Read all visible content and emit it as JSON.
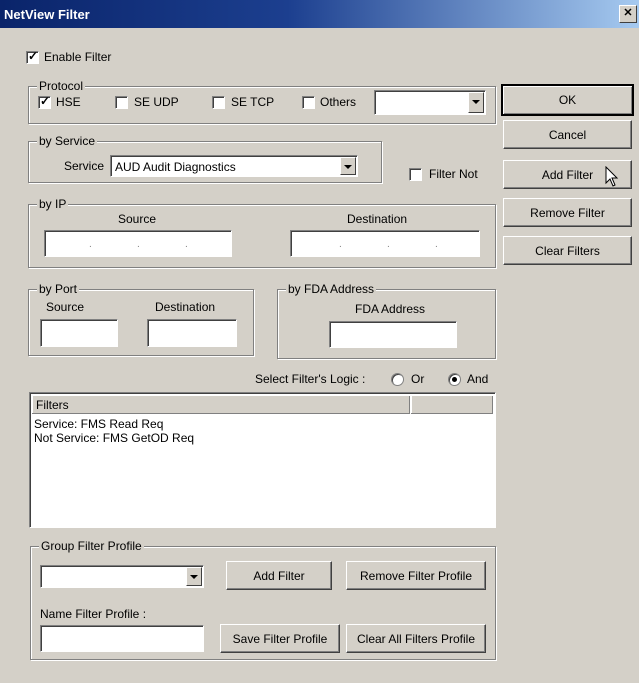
{
  "window": {
    "title": "NetView Filter",
    "close_glyph": "✕"
  },
  "enable_filter": {
    "label": "Enable Filter",
    "checked": true
  },
  "protocol": {
    "group_label": "Protocol",
    "options": [
      {
        "label": "HSE",
        "checked": true
      },
      {
        "label": "SE UDP",
        "checked": false
      },
      {
        "label": "SE TCP",
        "checked": false
      },
      {
        "label": "Others",
        "checked": false
      }
    ],
    "others_value": ""
  },
  "by_service": {
    "group_label": "by Service",
    "service_label": "Service",
    "service_value": "AUD Audit Diagnostics"
  },
  "filter_not": {
    "label": "Filter Not",
    "checked": false
  },
  "by_ip": {
    "group_label": "by IP",
    "source_label": "Source",
    "destination_label": "Destination"
  },
  "by_port": {
    "group_label": "by Port",
    "source_label": "Source",
    "destination_label": "Destination"
  },
  "by_fda": {
    "group_label": "by FDA Address",
    "fda_label": "FDA Address"
  },
  "logic": {
    "label": "Select Filter's Logic :",
    "or_label": "Or",
    "and_label": "And",
    "selected": "And"
  },
  "filters_list": {
    "header": "Filters",
    "rows": [
      "Service: FMS Read Req",
      "Not Service: FMS GetOD Req"
    ]
  },
  "group_profile": {
    "group_label": "Group Filter Profile",
    "profile_value": "",
    "add_filter_label": "Add Filter",
    "remove_profile_label": "Remove Filter Profile",
    "name_label": "Name Filter Profile :",
    "name_value": "",
    "save_label": "Save Filter Profile",
    "clear_all_label": "Clear All Filters Profile"
  },
  "side_buttons": {
    "ok": "OK",
    "cancel": "Cancel",
    "add_filter": "Add Filter",
    "remove_filter": "Remove Filter",
    "clear_filters": "Clear Filters"
  }
}
